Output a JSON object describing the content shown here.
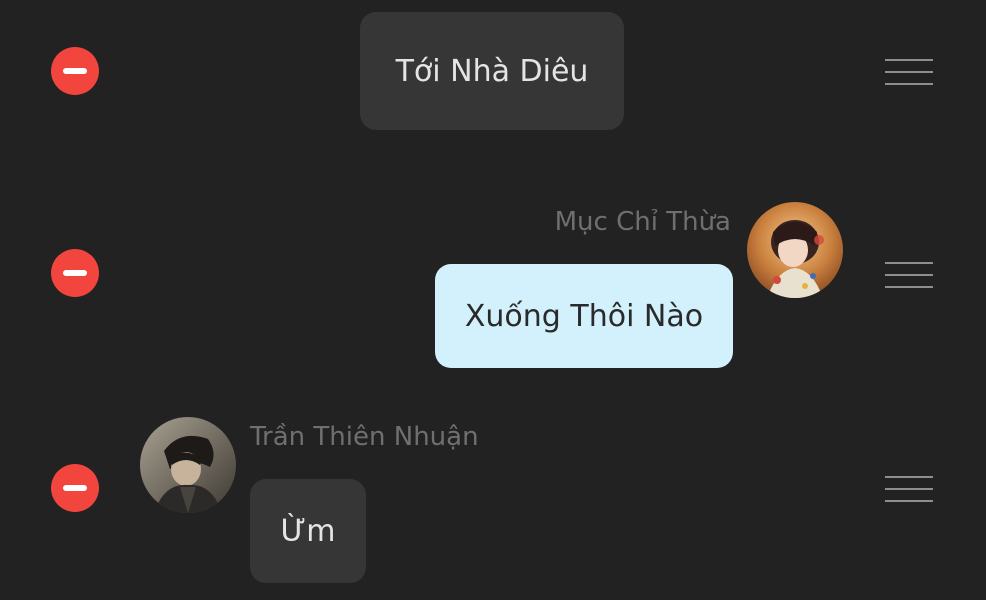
{
  "messages": [
    {
      "type": "narration",
      "text": "Tới Nhà Diêu"
    },
    {
      "type": "right",
      "sender": "Mục Chỉ Thừa",
      "text": "Xuống Thôi Nào",
      "avatar_icon": "girl-portrait-avatar"
    },
    {
      "type": "left",
      "sender": "Trần Thiên Nhuận",
      "text": "Ừm",
      "avatar_icon": "boy-portrait-avatar"
    }
  ],
  "colors": {
    "background": "#222222",
    "delete_button": "#f2453d",
    "bubble_dark": "#363636",
    "bubble_light": "#d2f1fd",
    "sender_text": "#6f6f6f",
    "handle": "#8e8e8e"
  }
}
